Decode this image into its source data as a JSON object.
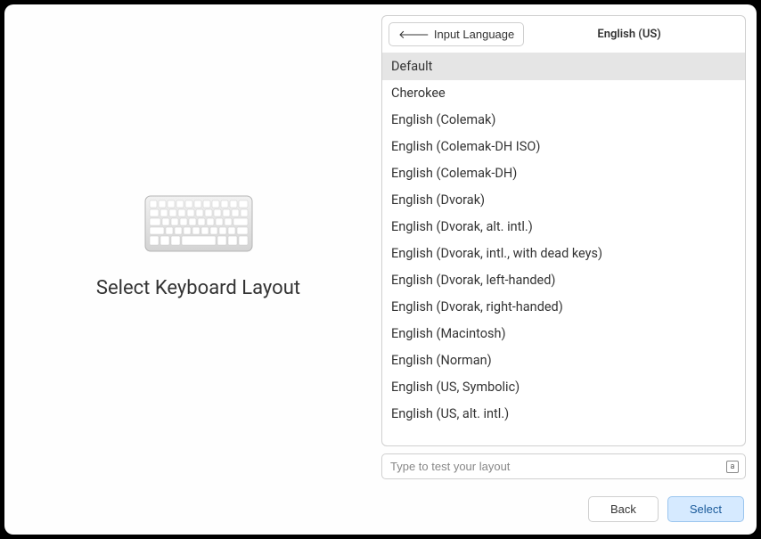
{
  "page_title": "Select Keyboard Layout",
  "header": {
    "back_label": "Input Language",
    "language_title": "English (US)"
  },
  "layouts": {
    "selected_index": 0,
    "items": [
      "Default",
      "Cherokee",
      "English (Colemak)",
      "English (Colemak-DH ISO)",
      "English (Colemak-DH)",
      "English (Dvorak)",
      "English (Dvorak, alt. intl.)",
      "English (Dvorak, intl., with dead keys)",
      "English (Dvorak, left-handed)",
      "English (Dvorak, right-handed)",
      "English (Macintosh)",
      "English (Norman)",
      "English (US, Symbolic)",
      "English (US, alt. intl.)"
    ]
  },
  "test_input": {
    "placeholder": "Type to test your layout",
    "indicator": "a"
  },
  "footer": {
    "back": "Back",
    "select": "Select"
  }
}
